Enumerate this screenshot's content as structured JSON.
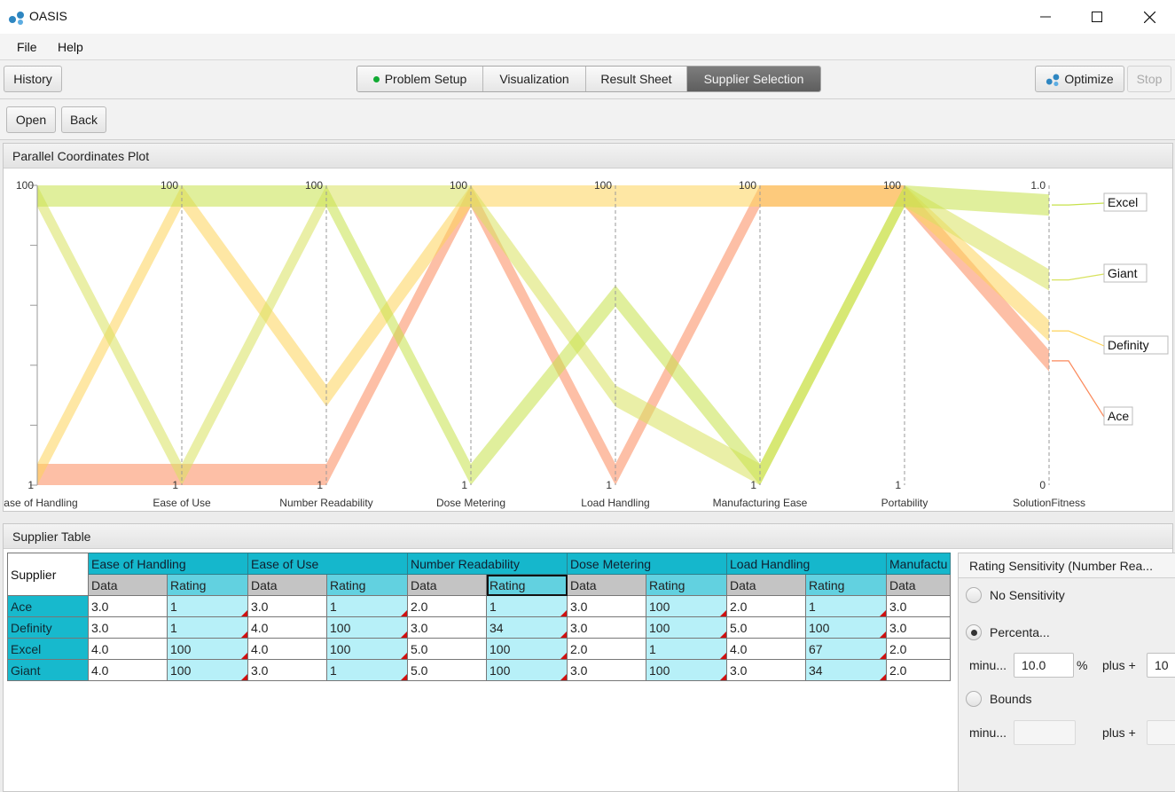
{
  "window": {
    "title": "OASIS"
  },
  "menu": [
    "File",
    "Help"
  ],
  "toolbar": {
    "history": "History",
    "tabs": [
      "Problem Setup",
      "Visualization",
      "Result Sheet",
      "Supplier Selection"
    ],
    "active_tab": "Supplier Selection",
    "optimize": "Optimize",
    "stop": "Stop"
  },
  "subtoolbar": {
    "open": "Open",
    "back": "Back"
  },
  "plot": {
    "title": "Parallel Coordinates Plot",
    "colors": {
      "Ace": "#fb8a5c",
      "Definity": "#fed35a",
      "Excel": "#c6e14a",
      "Giant": "#d8e25e",
      "Orange": "#f59a2a"
    }
  },
  "chart_data": {
    "type": "parallel-coordinates",
    "axes": [
      {
        "name": "Ease of Handling",
        "max": "100",
        "min": "1"
      },
      {
        "name": "Ease of Use",
        "max": "100",
        "min": "1"
      },
      {
        "name": "Number Readability",
        "max": "100",
        "min": "1"
      },
      {
        "name": "Dose Metering",
        "max": "100",
        "min": "1"
      },
      {
        "name": "Load Handling",
        "max": "100",
        "min": "1"
      },
      {
        "name": "Manufacturing Ease",
        "max": "100",
        "min": "1"
      },
      {
        "name": "Portability",
        "max": "100",
        "min": "1"
      },
      {
        "name": "SolutionFitness",
        "max": "1.0",
        "min": "0"
      }
    ],
    "series": [
      {
        "name": "Ace",
        "color": "#fb8a5c",
        "values": [
          1,
          1,
          1,
          100,
          1,
          100,
          100,
          0.45
        ]
      },
      {
        "name": "Definity",
        "color": "#fed35a",
        "values": [
          1,
          100,
          34,
          100,
          100,
          100,
          100,
          0.55
        ]
      },
      {
        "name": "Excel",
        "color": "#c6e14a",
        "values": [
          100,
          100,
          100,
          1,
          67,
          1,
          100,
          0.97
        ]
      },
      {
        "name": "Giant",
        "color": "#d8e25e",
        "values": [
          100,
          1,
          100,
          100,
          34,
          1,
          100,
          0.72
        ]
      }
    ],
    "legend": [
      "Excel",
      "Giant",
      "Definity",
      "Ace"
    ],
    "legend_position": "right"
  },
  "table": {
    "title": "Supplier Table",
    "supplier_header": "Supplier",
    "groups": [
      "Ease of Handling",
      "Ease of Use",
      "Number Readability",
      "Dose Metering",
      "Load Handling",
      "Manufactu"
    ],
    "sub_data": "Data",
    "sub_rating": "Rating",
    "rows": [
      {
        "name": "Ace",
        "cells": [
          "3.0",
          "1",
          "3.0",
          "1",
          "2.0",
          "1",
          "3.0",
          "100",
          "2.0",
          "1",
          "3.0"
        ]
      },
      {
        "name": "Definity",
        "cells": [
          "3.0",
          "1",
          "4.0",
          "100",
          "3.0",
          "34",
          "3.0",
          "100",
          "5.0",
          "100",
          "3.0"
        ]
      },
      {
        "name": "Excel",
        "cells": [
          "4.0",
          "100",
          "4.0",
          "100",
          "5.0",
          "100",
          "2.0",
          "1",
          "4.0",
          "67",
          "2.0"
        ]
      },
      {
        "name": "Giant",
        "cells": [
          "4.0",
          "100",
          "3.0",
          "1",
          "5.0",
          "100",
          "3.0",
          "100",
          "3.0",
          "34",
          "2.0"
        ]
      }
    ]
  },
  "sensitivity": {
    "title": "Rating Sensitivity (Number Rea...",
    "no_sensitivity": "No Sensitivity",
    "percentage": "Percenta...",
    "minus_label": "minu...",
    "minus_value": "10.0",
    "percent_sign": "%",
    "plus_label": "plus +",
    "plus_value": "10",
    "bounds": "Bounds",
    "bounds_minus_label": "minu...",
    "bounds_plus_label": "plus +"
  }
}
